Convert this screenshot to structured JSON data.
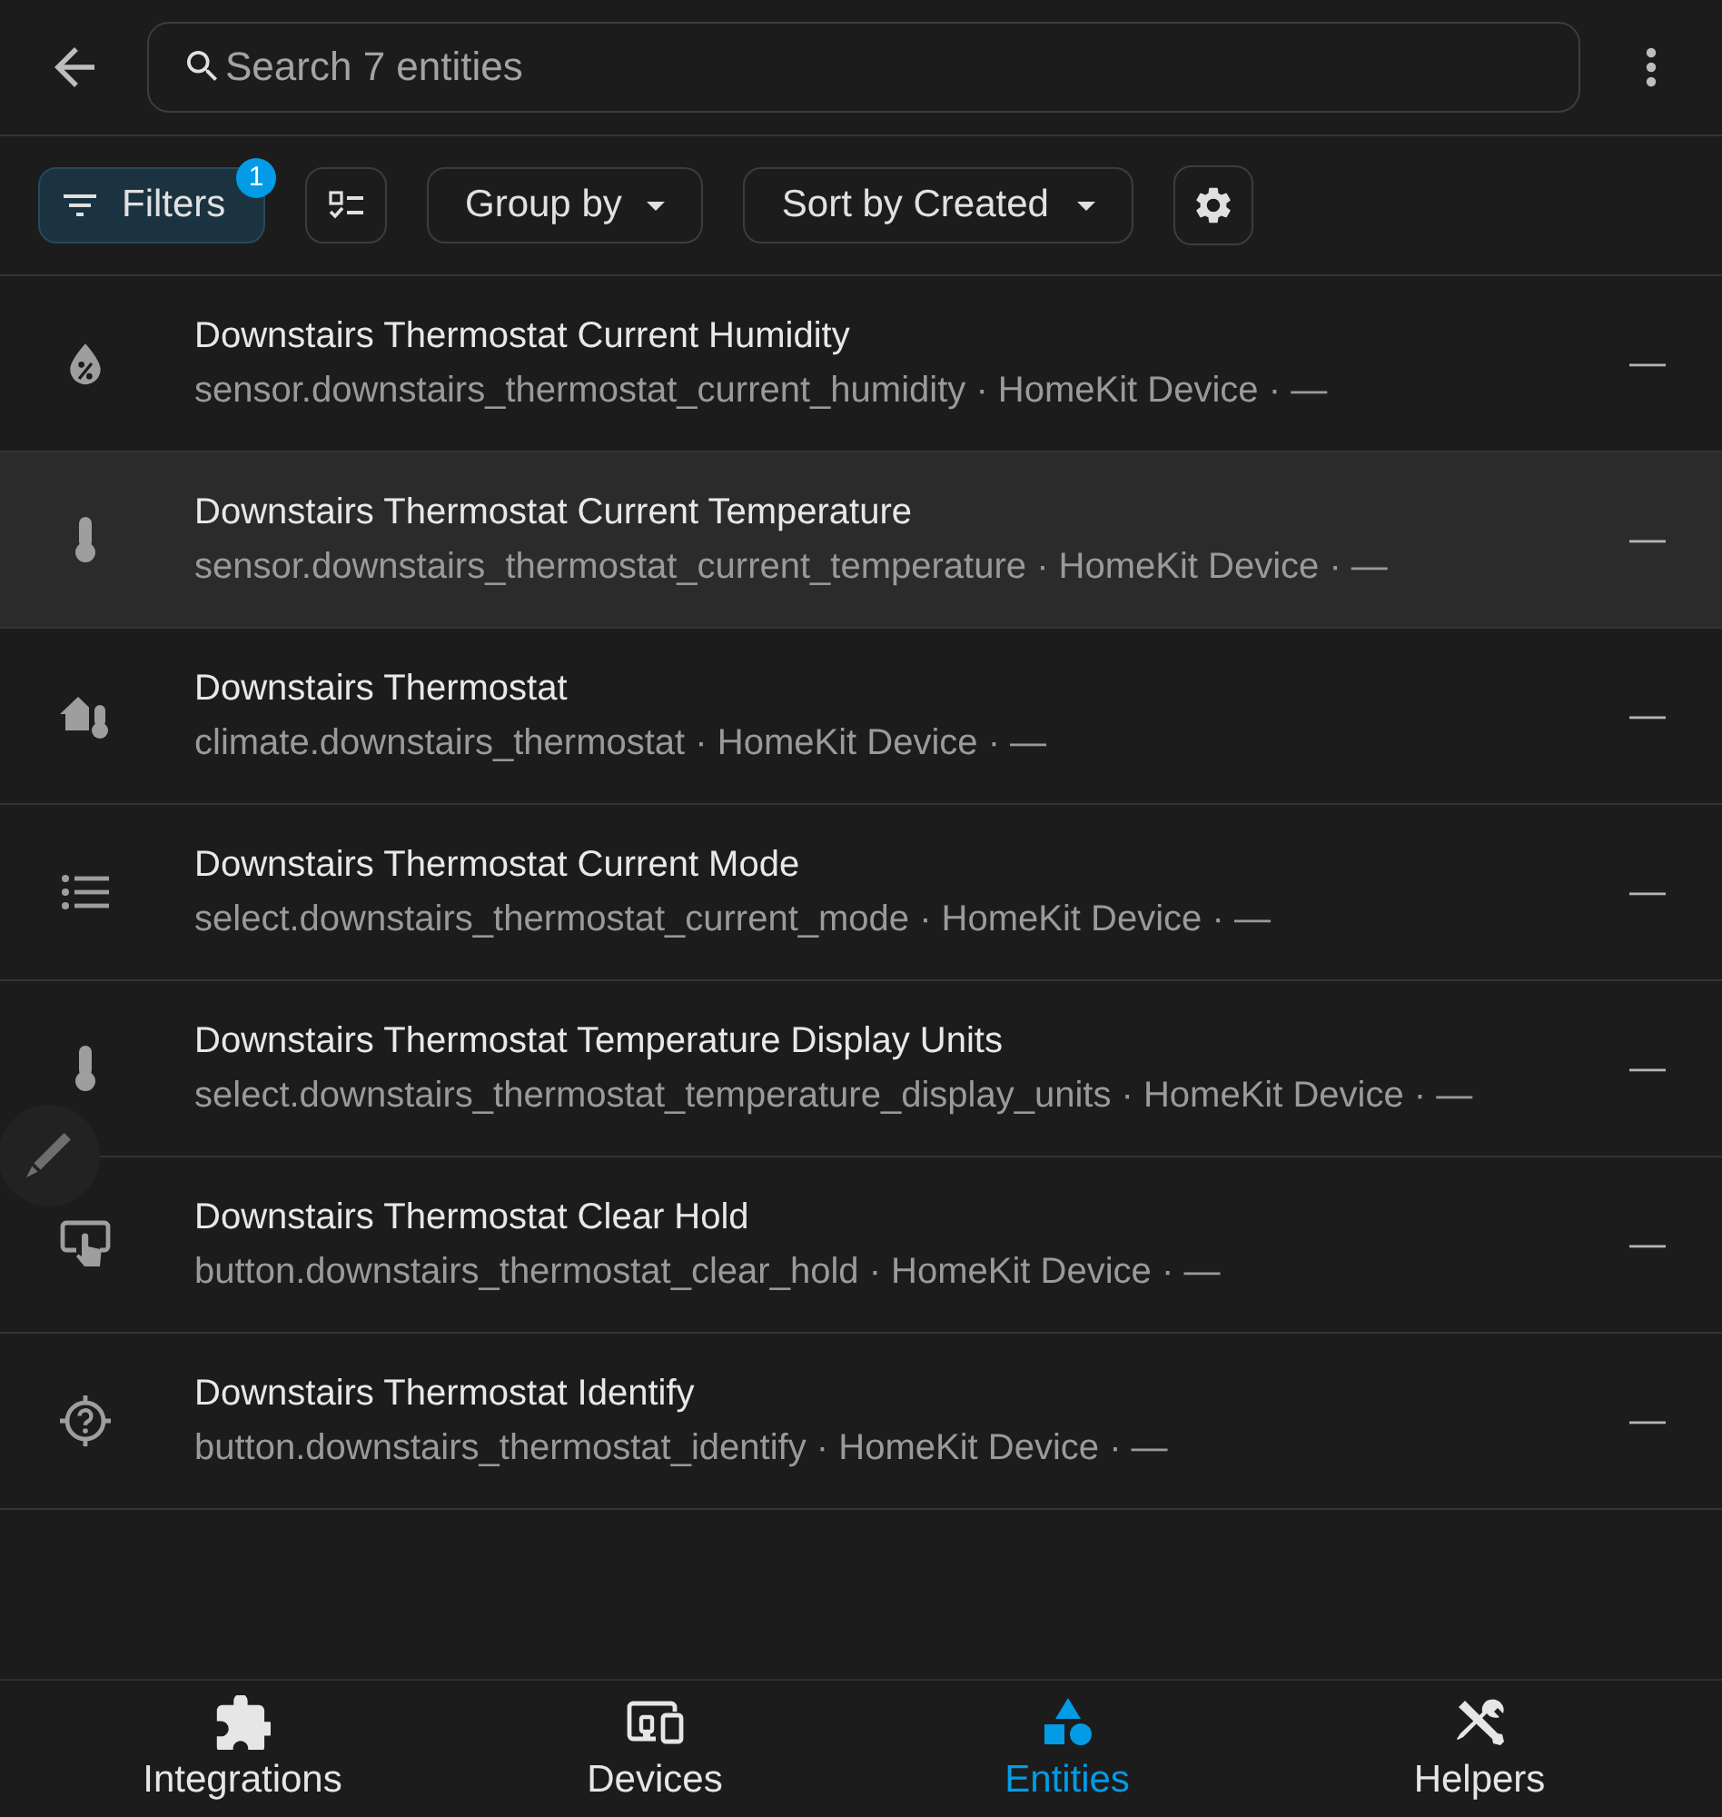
{
  "header": {
    "search": {
      "placeholder": "Search 7 entities"
    }
  },
  "toolbar": {
    "filters": {
      "label": "Filters",
      "badge": "1",
      "active": true
    },
    "group_by": {
      "label": "Group by"
    },
    "sort": {
      "label": "Sort by Created"
    }
  },
  "entities": [
    {
      "name": "Downstairs Thermostat Current Humidity",
      "subtitle": "sensor.downstairs_thermostat_current_humidity · HomeKit Device · —",
      "status": "—",
      "highlighted": false
    },
    {
      "name": "Downstairs Thermostat Current Temperature",
      "subtitle": "sensor.downstairs_thermostat_current_temperature · HomeKit Device · —",
      "status": "—",
      "highlighted": true
    },
    {
      "name": "Downstairs Thermostat",
      "subtitle": "climate.downstairs_thermostat · HomeKit Device · —",
      "status": "—",
      "highlighted": false
    },
    {
      "name": "Downstairs Thermostat Current Mode",
      "subtitle": "select.downstairs_thermostat_current_mode · HomeKit Device · —",
      "status": "—",
      "highlighted": false
    },
    {
      "name": "Downstairs Thermostat Temperature Display Units",
      "subtitle": "select.downstairs_thermostat_temperature_display_units · HomeKit Device · —",
      "status": "—",
      "highlighted": false
    },
    {
      "name": "Downstairs Thermostat Clear Hold",
      "subtitle": "button.downstairs_thermostat_clear_hold · HomeKit Device · —",
      "status": "—",
      "highlighted": false
    },
    {
      "name": "Downstairs Thermostat Identify",
      "subtitle": "button.downstairs_thermostat_identify · HomeKit Device · —",
      "status": "—",
      "highlighted": false
    }
  ],
  "bottom_nav": [
    {
      "label": "Integrations",
      "selected": false
    },
    {
      "label": "Devices",
      "selected": false
    },
    {
      "label": "Entities",
      "selected": true
    },
    {
      "label": "Helpers",
      "selected": false
    }
  ]
}
